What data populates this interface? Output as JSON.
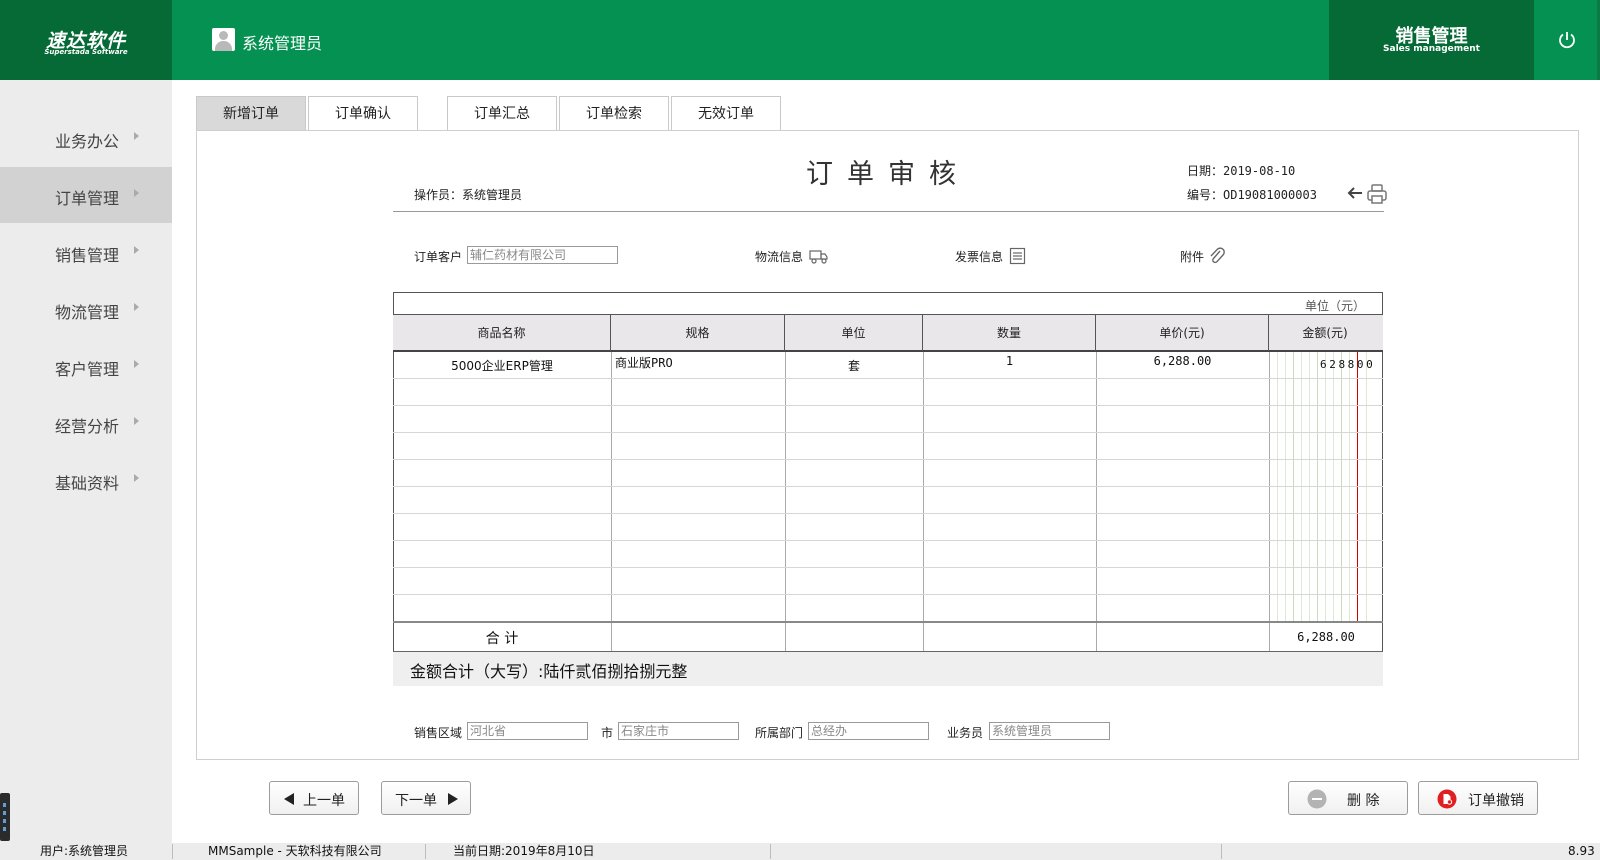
{
  "brand": {
    "name": "速达软件",
    "sub": "Superstada Software"
  },
  "header": {
    "user": "系统管理员",
    "module_cn": "销售管理",
    "module_en": "Sales management",
    "power_icon": "power-icon"
  },
  "sidebar": {
    "items": [
      {
        "label": "业务办公"
      },
      {
        "label": "订单管理",
        "active": true
      },
      {
        "label": "销售管理"
      },
      {
        "label": "物流管理"
      },
      {
        "label": "客户管理"
      },
      {
        "label": "经营分析"
      },
      {
        "label": "基础资料"
      }
    ]
  },
  "tabs": [
    {
      "label": "新增订单",
      "active": true
    },
    {
      "label": "订单确认"
    },
    {
      "label": "订单汇总"
    },
    {
      "label": "订单检索"
    },
    {
      "label": "无效订单"
    }
  ],
  "order": {
    "title": "订单审核",
    "operator_label": "操作员：系统管理员",
    "date_label": "日期：2019-08-10",
    "number_label": "编号：OD19081000003",
    "customer_label": "订单客户",
    "customer_value": "辅仁药材有限公司",
    "logistics_label": "物流信息",
    "invoice_label": "发票信息",
    "attachment_label": "附件",
    "unit_note": "单位（元）"
  },
  "table": {
    "headers": [
      "商品名称",
      "规格",
      "单位",
      "数量",
      "单价(元)",
      "金额(元)"
    ],
    "rows": [
      {
        "name": "5000企业ERP管理",
        "spec": "商业版PRO",
        "unit": "套",
        "qty": "1",
        "price": "6,288.00",
        "amount_digits": "628800"
      }
    ],
    "total_label": "合  计",
    "total_amount": "6,288.00",
    "amount_in_words": "金额合计（大写）:陆仟贰佰捌拾捌元整"
  },
  "footer_fields": {
    "region_label": "销售区域",
    "region_value": "河北省",
    "city_label": "市",
    "city_value": "石家庄市",
    "dept_label": "所属部门",
    "dept_value": "总经办",
    "salesman_label": "业务员",
    "salesman_value": "系统管理员"
  },
  "buttons": {
    "prev": "上一单",
    "next": "下一单",
    "delete": "删  除",
    "revoke": "订单撤销"
  },
  "statusbar": {
    "user": "用户:系统管理员",
    "app": "MMSample - 天软科技有限公司",
    "date": "当前日期:2019年8月10日",
    "version": "8.93"
  },
  "colors": {
    "header_green": "#059152",
    "dark_green": "#066a37",
    "red_line": "#d40000"
  }
}
